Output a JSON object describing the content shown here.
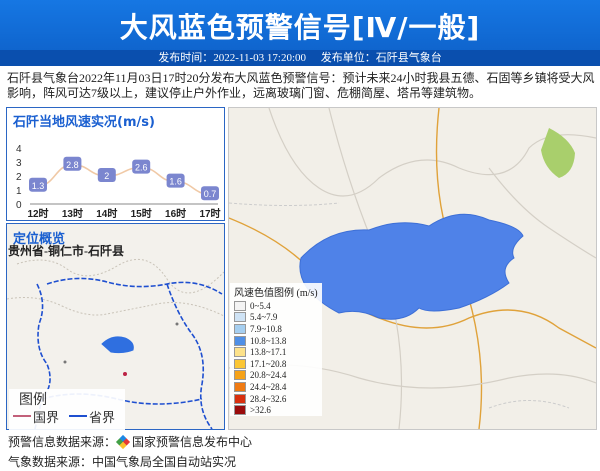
{
  "header": {
    "title": "大风蓝色预警信号[Ⅳ/一般]",
    "issue_time": "发布时间：2022-11-03 17:20:00",
    "issue_unit": "发布单位：石阡县气象台"
  },
  "description": "石阡县气象台2022年11月03日17时20分发布大风蓝色预警信号：预计未来24小时我县五德、石固等乡镇将受大风影响，阵风可达7级以上，建议停止户外作业，远离玻璃门窗、危棚简屋、塔吊等建筑物。",
  "wind_panel": {
    "title": "石阡当地风速实况(m/s)",
    "chart_data": {
      "type": "line",
      "title": "石阡当地风速实况(m/s)",
      "categories": [
        "12时",
        "13时",
        "14时",
        "15时",
        "16时",
        "17时"
      ],
      "values": [
        1.3,
        2.8,
        2.0,
        2.6,
        1.6,
        0.7
      ],
      "ylim": [
        0,
        4
      ],
      "yticks": [
        0,
        1,
        2,
        3,
        4
      ],
      "line_color": "#f0c9a6",
      "label_color": "#7b86cf"
    }
  },
  "location_panel": {
    "title": "定位概览",
    "location": "贵州省-铜仁市-石阡县",
    "legend_title": "图例",
    "legend_items": [
      {
        "label": "国界",
        "color": "#c2607a"
      },
      {
        "label": "省界",
        "color": "#1e4fd0"
      }
    ]
  },
  "color_legend": {
    "title": "风速色值图例 (m/s)",
    "items": [
      {
        "label": "0~5.4",
        "color": "#f4f4f4"
      },
      {
        "label": "5.4~7.9",
        "color": "#cfe3f5"
      },
      {
        "label": "7.9~10.8",
        "color": "#a6cff0"
      },
      {
        "label": "10.8~13.8",
        "color": "#4f8fe6"
      },
      {
        "label": "13.8~17.1",
        "color": "#fde28a"
      },
      {
        "label": "17.1~20.8",
        "color": "#fbc634"
      },
      {
        "label": "20.8~24.4",
        "color": "#f5a218"
      },
      {
        "label": "24.4~28.4",
        "color": "#ef7a12"
      },
      {
        "label": "28.4~32.6",
        "color": "#d9300f"
      },
      {
        "label": ">32.6",
        "color": "#9a0c0c"
      }
    ]
  },
  "footer": {
    "source1_label": "预警信息数据来源：",
    "source1_value": "国家预警信息发布中心",
    "source2": "气象数据来源：中国气象局全国自动站实况"
  }
}
